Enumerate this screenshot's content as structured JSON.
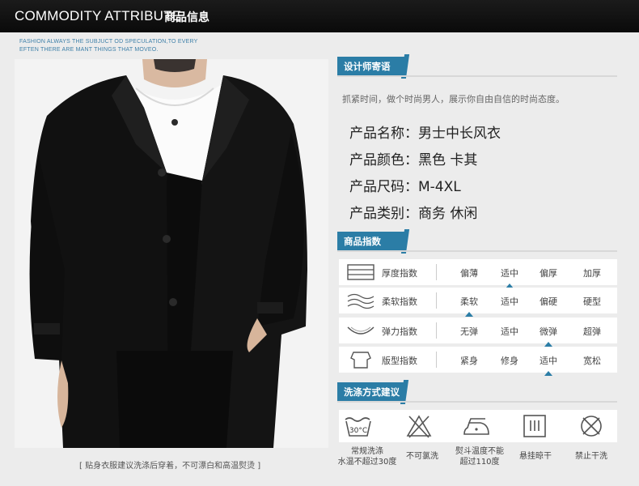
{
  "header": {
    "title_en": "COMMODITY ATTRIBUTE",
    "title_cn": "商品信息"
  },
  "tagline": [
    "FASHION ALWAYS THE SUBJUCT OD SPECULATION,TO EVERY",
    "EFTEN THERE ARE MANT THINGS THAT MOVEO."
  ],
  "photo": {
    "subject": "man-in-black-trench-coat"
  },
  "caption": "[ 贴身衣服建议洗涤后穿着，不可漂白和高温熨烫 ]",
  "designer_note": {
    "heading": "设计师寄语",
    "text": "抓紧时间，做个时尚男人，展示你自由自信的时尚态度。"
  },
  "attributes": [
    {
      "text": "产品名称：男士中长风衣"
    },
    {
      "text": "产品颜色：黑色 卡其"
    },
    {
      "text": "产品尺码：M-4XL"
    },
    {
      "text": "产品类别：商务 休闲"
    }
  ],
  "index": {
    "heading": "商品指数",
    "accent": "#2b7da6",
    "rows": [
      {
        "label": "厚度指数",
        "icon": "fabric-thickness-icon",
        "levels": [
          "偏薄",
          "适中",
          "偏厚",
          "加厚"
        ],
        "selected": 1
      },
      {
        "label": "柔软指数",
        "icon": "softness-wave-icon",
        "levels": [
          "柔软",
          "适中",
          "偏硬",
          "硬型"
        ],
        "selected": 0
      },
      {
        "label": "弹力指数",
        "icon": "elasticity-curve-icon",
        "levels": [
          "无弹",
          "适中",
          "微弹",
          "超弹"
        ],
        "selected": 2
      },
      {
        "label": "版型指数",
        "icon": "fit-shape-icon",
        "levels": [
          "紧身",
          "修身",
          "适中",
          "宽松"
        ],
        "selected": 2
      }
    ]
  },
  "washing": {
    "heading": "洗涤方式建议",
    "items": [
      {
        "icon": "wash-30c-icon",
        "icon_text": "30°C",
        "line1": "常规洗涤",
        "line2": "水温不超过30度"
      },
      {
        "icon": "no-bleach-icon",
        "line1": "不可氯洗",
        "line2": ""
      },
      {
        "icon": "iron-icon",
        "line1": "熨斗温度不能",
        "line2": "超过110度"
      },
      {
        "icon": "hang-dry-shade-icon",
        "line1": "悬挂晾干",
        "line2": ""
      },
      {
        "icon": "no-tumble-dry-icon",
        "line1": "禁止干洗",
        "line2": ""
      }
    ]
  }
}
